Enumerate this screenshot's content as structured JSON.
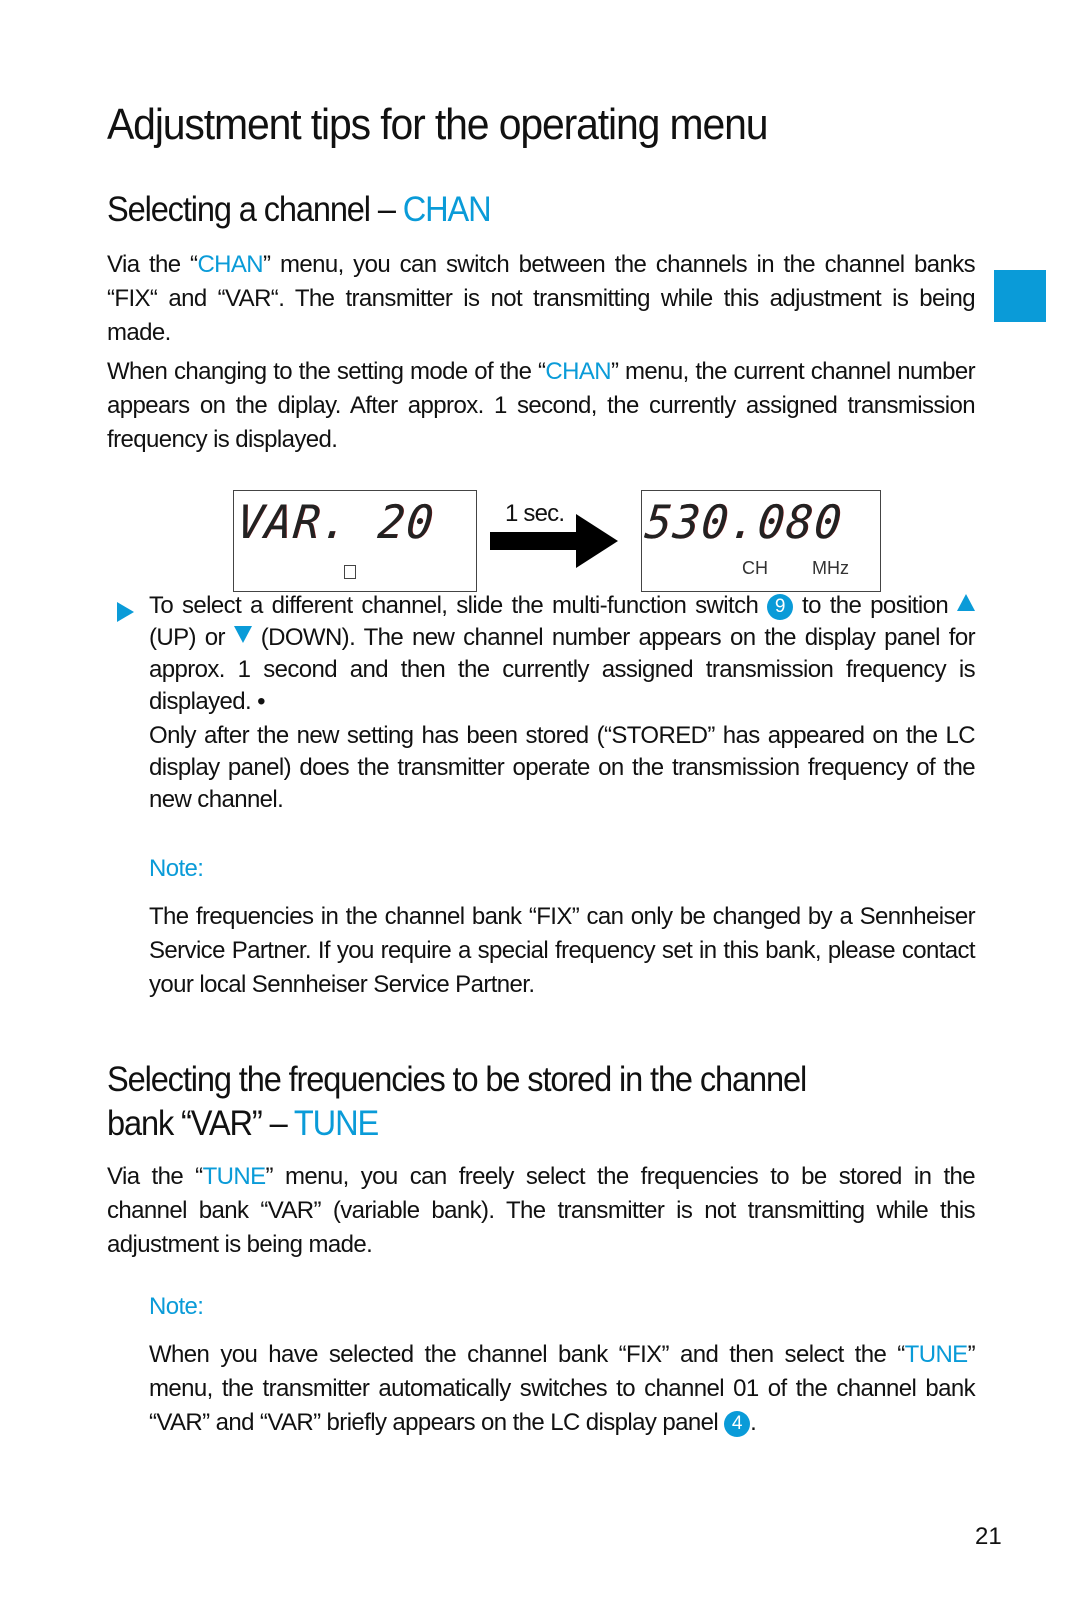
{
  "page": {
    "title": "Adjustment tips for the operating menu",
    "page_number": "21",
    "accent_color": "#0a9bd8"
  },
  "section1": {
    "heading_prefix": "Selecting a channel – ",
    "heading_accent": "CHAN",
    "p1": {
      "a": "Via the “",
      "accent": "CHAN",
      "b": "” menu, you can switch between the channels in the channel banks “FIX“ and “VAR“. The transmitter is not transmitting while this adjustment is being made."
    },
    "p2": {
      "a": "When changing to the setting mode of the “",
      "accent": "CHAN",
      "b": "” menu, the current channel number appears on the diplay. After approx. 1 second, the currently assigned transmission frequency is displayed."
    },
    "figure": {
      "lcd_left_text": "VAR. 20",
      "delay_label": "1 sec.",
      "lcd_right_text": "530.080",
      "lcd_right_label_ch": "CH",
      "lcd_right_label_mhz": "MHz"
    },
    "step": {
      "a": "To select a different channel, slide the multi-function switch ",
      "switch_number": "9",
      "b": " to the position ",
      "up_label": " (UP) or ",
      "down_label": " (DOWN). The new channel number appears on the display panel for approx. 1 second and then the currently assigned transmission frequency is displayed. •"
    },
    "step_followup": "Only after the new setting has been stored (“STORED” has appeared on the LC display panel) does the transmitter operate on the transmission frequency of the new channel.",
    "note_label": "Note:",
    "note_text": "The frequencies in the channel bank “FIX” can only be changed by a Sennheiser Service Partner. If you require a special frequency set in this bank, please contact your local Sennheiser Service Partner."
  },
  "section2": {
    "heading_line1": "Selecting the frequencies to be stored in the channel",
    "heading_line2_prefix": "bank “VAR” – ",
    "heading_accent": "TUNE",
    "p1": {
      "a": "Via the “",
      "accent": "TUNE",
      "b": "” menu, you can freely select the frequencies to be stored in the channel bank “VAR” (variable bank). The transmitter is not transmitting while this adjustment is being made."
    },
    "note_label": "Note:",
    "note": {
      "a": "When you have selected the channel bank “FIX” and then select the “",
      "accent": "TUNE",
      "b": "” menu, the transmitter automatically switches to channel 01 of the channel bank “VAR” and “VAR” briefly appears on the LC display panel ",
      "panel_number": "4",
      "c": "."
    }
  }
}
